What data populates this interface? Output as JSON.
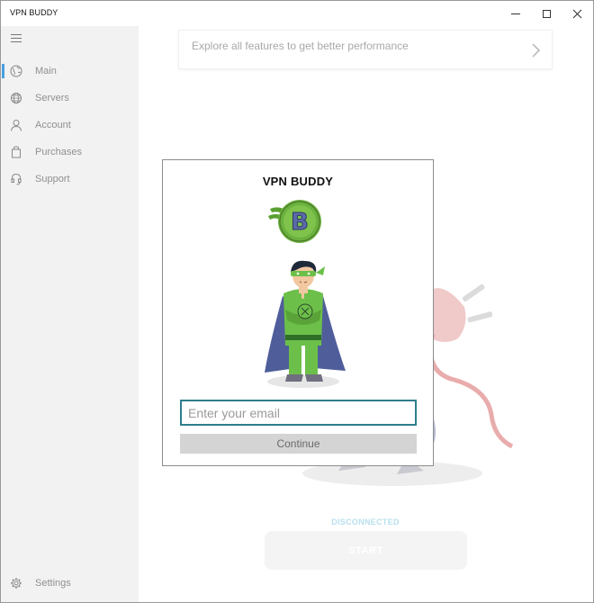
{
  "window": {
    "title": "VPN BUDDY"
  },
  "sidebar": {
    "items": [
      {
        "label": "Main",
        "icon": "globe-icon",
        "active": true
      },
      {
        "label": "Servers",
        "icon": "servers-globe-icon",
        "active": false
      },
      {
        "label": "Account",
        "icon": "person-icon",
        "active": false
      },
      {
        "label": "Purchases",
        "icon": "bag-icon",
        "active": false
      },
      {
        "label": "Support",
        "icon": "headset-icon",
        "active": false
      }
    ],
    "settings_label": "Settings"
  },
  "main": {
    "banner_text": "Explore all features to get better performance",
    "status_text": "DISCONNECTED",
    "start_label": "START"
  },
  "modal": {
    "title": "VPN BUDDY",
    "email_placeholder": "Enter your email",
    "email_value": "",
    "continue_label": "Continue"
  },
  "colors": {
    "accent": "#4a9fe0",
    "input_border": "#2e7d8c",
    "status": "#b8e0ee",
    "logo_green": "#6ab23e"
  }
}
